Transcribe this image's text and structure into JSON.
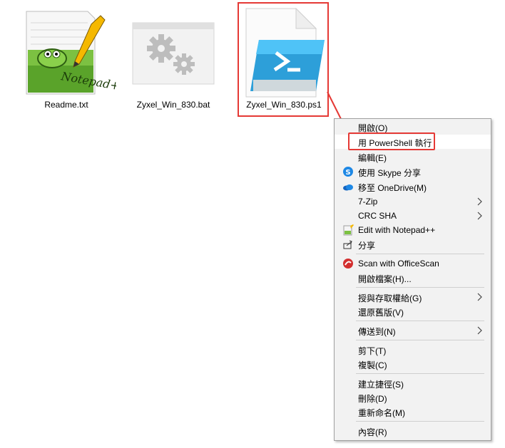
{
  "files": [
    {
      "name": "Readme.txt",
      "icon": "notepad-plus-plus-icon"
    },
    {
      "name": "Zyxel_Win_830.bat",
      "icon": "batch-file-gears-icon"
    },
    {
      "name": "Zyxel_Win_830.ps1",
      "icon": "powershell-script-icon"
    }
  ],
  "context_menu": {
    "items": [
      {
        "label": "開啟(O)"
      },
      {
        "label": "用 PowerShell 執行"
      },
      {
        "label": "編輯(E)"
      },
      {
        "label": "使用 Skype 分享",
        "icon": "skype-icon"
      },
      {
        "label": "移至 OneDrive(M)",
        "icon": "onedrive-cloud-icon"
      },
      {
        "label": "7-Zip"
      },
      {
        "label": "CRC SHA"
      },
      {
        "label": "Edit with Notepad++",
        "icon": "notepad-plus-plus-icon"
      },
      {
        "label": "分享",
        "icon": "share-icon"
      },
      {
        "label": "Scan with OfficeScan",
        "icon": "trendmicro-icon"
      },
      {
        "label": "開啟檔案(H)..."
      },
      {
        "label": "授與存取權給(G)"
      },
      {
        "label": "還原舊版(V)"
      },
      {
        "label": "傳送到(N)"
      },
      {
        "label": "剪下(T)"
      },
      {
        "label": "複製(C)"
      },
      {
        "label": "建立捷徑(S)"
      },
      {
        "label": "刪除(D)"
      },
      {
        "label": "重新命名(M)"
      },
      {
        "label": "內容(R)"
      }
    ]
  },
  "colors": {
    "highlight": "#e53935",
    "accent_blue": "#1e88e5"
  }
}
